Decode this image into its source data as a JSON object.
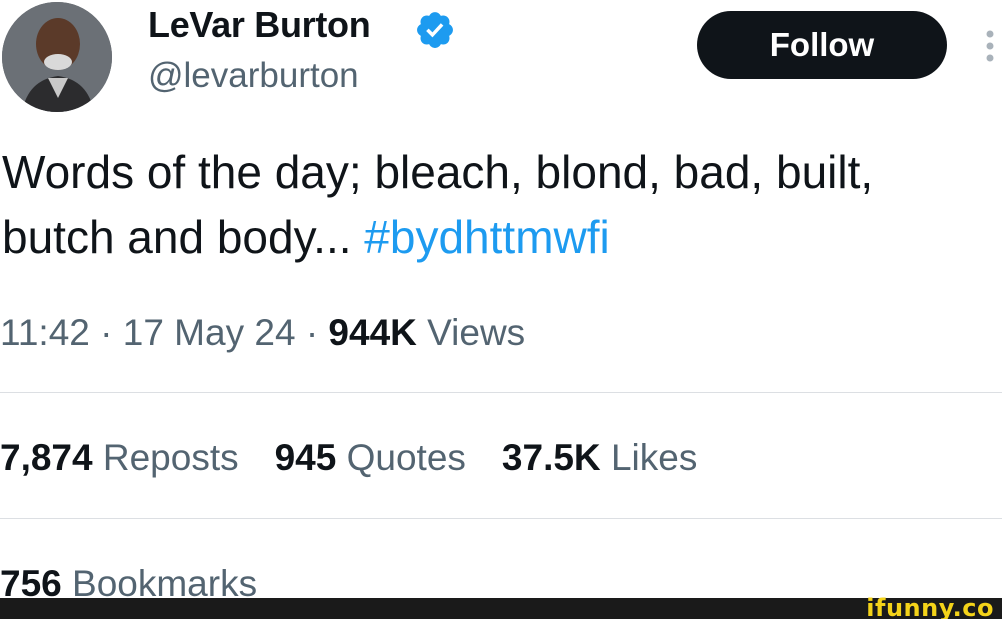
{
  "profile": {
    "display_name": "LeVar Burton",
    "handle": "@levarburton",
    "avatar": "avatar",
    "verified_icon": "verified-badge-icon"
  },
  "header": {
    "follow_label": "Follow",
    "more_icon": "vertical-ellipsis-icon"
  },
  "tweet": {
    "line1": "Words of the day; bleach, blond, bad, built,",
    "line2_text": "butch and body... ",
    "hashtag": "#bydhttmwfi"
  },
  "meta": {
    "time": "11:42",
    "separator": "·",
    "date": "17 May 24",
    "views_count": "944K",
    "views_label": "Views"
  },
  "stats": {
    "reposts_count": "7,874",
    "reposts_label": "Reposts",
    "quotes_count": "945",
    "quotes_label": "Quotes",
    "likes_count": "37.5K",
    "likes_label": "Likes",
    "bookmarks_count": "756",
    "bookmarks_label": "Bookmarks"
  },
  "watermark": {
    "text": "ifunny.co"
  },
  "colors": {
    "text_primary": "#0f1419",
    "text_secondary": "#536471",
    "link": "#1d9bf0",
    "follow_bg": "#0f1419",
    "divider": "#dcdfe3"
  }
}
